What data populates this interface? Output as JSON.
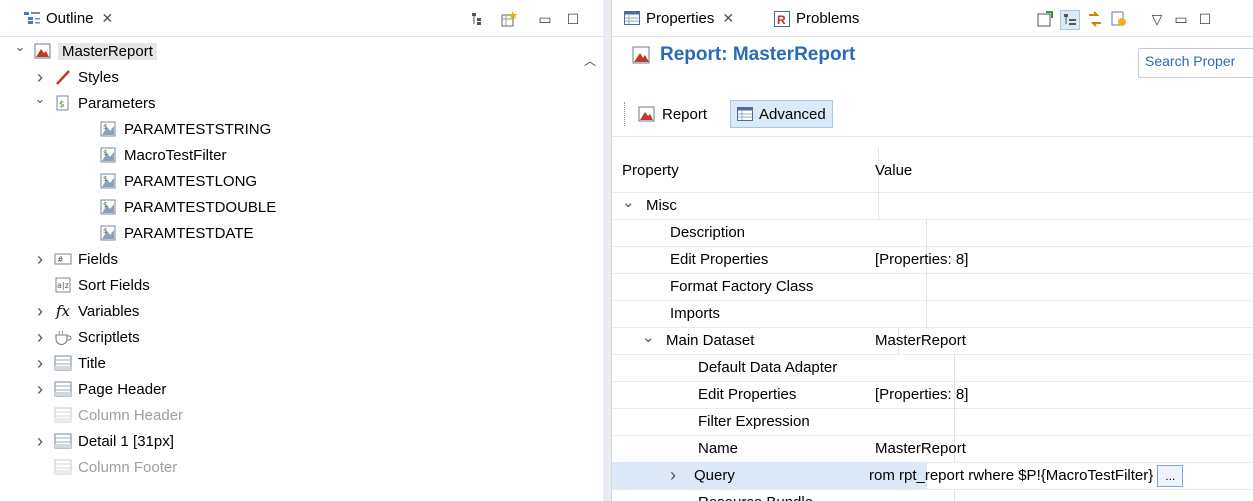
{
  "outline": {
    "tab_label": "Outline",
    "tree": [
      {
        "label": "MasterReport",
        "icon": "report-icon",
        "twisty": "open",
        "indent": 0,
        "selected": true
      },
      {
        "label": "Styles",
        "icon": "styles-icon",
        "twisty": "closed",
        "indent": 1
      },
      {
        "label": "Parameters",
        "icon": "parameters-icon",
        "twisty": "open",
        "indent": 1
      },
      {
        "label": "PARAMTESTSTRING",
        "icon": "parameter-icon",
        "twisty": "none",
        "indent": 2
      },
      {
        "label": "MacroTestFilter",
        "icon": "parameter-icon",
        "twisty": "none",
        "indent": 2
      },
      {
        "label": "PARAMTESTLONG",
        "icon": "parameter-icon",
        "twisty": "none",
        "indent": 2
      },
      {
        "label": "PARAMTESTDOUBLE",
        "icon": "parameter-icon",
        "twisty": "none",
        "indent": 2
      },
      {
        "label": "PARAMTESTDATE",
        "icon": "parameter-icon",
        "twisty": "none",
        "indent": 2
      },
      {
        "label": "Fields",
        "icon": "fields-icon",
        "twisty": "closed",
        "indent": 1
      },
      {
        "label": "Sort Fields",
        "icon": "sort-fields-icon",
        "twisty": "none",
        "indent": 1
      },
      {
        "label": "Variables",
        "icon": "variables-icon",
        "twisty": "closed",
        "indent": 1
      },
      {
        "label": "Scriptlets",
        "icon": "scriptlets-icon",
        "twisty": "closed",
        "indent": 1
      },
      {
        "label": "Title",
        "icon": "band-icon",
        "twisty": "closed",
        "indent": 1
      },
      {
        "label": "Page Header",
        "icon": "band-icon",
        "twisty": "closed",
        "indent": 1
      },
      {
        "label": "Column Header",
        "icon": "band-icon",
        "twisty": "none",
        "indent": 1,
        "disabled": true
      },
      {
        "label": "Detail 1 [31px]",
        "icon": "band-icon",
        "twisty": "closed",
        "indent": 1
      },
      {
        "label": "Column Footer",
        "icon": "band-icon",
        "twisty": "none",
        "indent": 1,
        "disabled": true
      }
    ]
  },
  "properties": {
    "tab_label": "Properties",
    "problems_tab_label": "Problems",
    "title": "Report: MasterReport",
    "search_placeholder": "Search Proper",
    "subtabs": {
      "report": "Report",
      "advanced": "Advanced"
    },
    "header": {
      "property": "Property",
      "value": "Value"
    },
    "rows": [
      {
        "name": "Misc",
        "value": "",
        "indent": 0,
        "twisty": "open"
      },
      {
        "name": "Description",
        "value": "",
        "indent": 2,
        "twisty": "none"
      },
      {
        "name": "Edit Properties",
        "value": "[Properties: 8]",
        "indent": 2,
        "twisty": "none"
      },
      {
        "name": "Format Factory Class",
        "value": "",
        "indent": 2,
        "twisty": "none"
      },
      {
        "name": "Imports",
        "value": "",
        "indent": 2,
        "twisty": "none"
      },
      {
        "name": "Main Dataset",
        "value": "MasterReport",
        "indent": 1,
        "twisty": "open"
      },
      {
        "name": "Default Data Adapter",
        "value": "",
        "indent": 3,
        "twisty": "none"
      },
      {
        "name": "Edit Properties",
        "value": "[Properties: 8]",
        "indent": 3,
        "twisty": "none"
      },
      {
        "name": "Filter Expression",
        "value": "",
        "indent": 3,
        "twisty": "none"
      },
      {
        "name": "Name",
        "value": "MasterReport",
        "indent": 3,
        "twisty": "none"
      },
      {
        "name": "Query",
        "value": "rom rpt_report rwhere  $P!{MacroTestFilter}",
        "indent": 2,
        "twisty": "closed",
        "highlight": true,
        "ellipsis": "..."
      },
      {
        "name": "Resource Bundle",
        "value": "",
        "indent": 3,
        "twisty": "none"
      }
    ]
  },
  "colors": {
    "accent": "#2a6ab8",
    "selection": "#dde8f6"
  }
}
